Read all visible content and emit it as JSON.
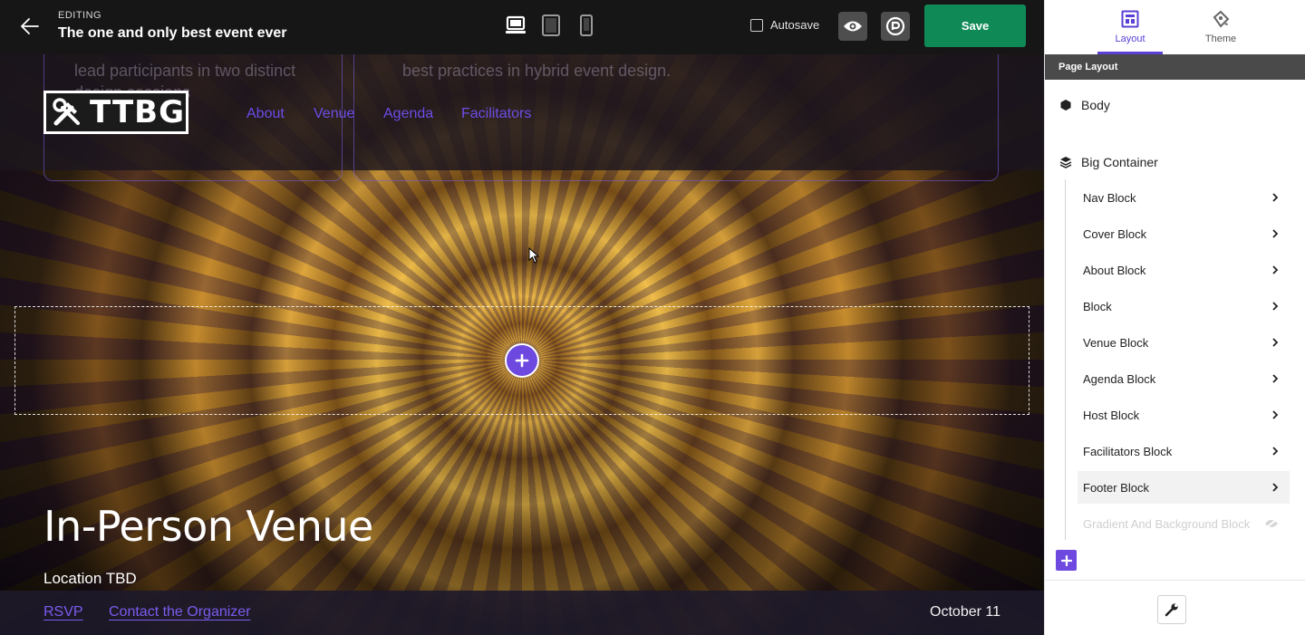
{
  "editor": {
    "editing_label": "EDITING",
    "title": "The one and only best event ever",
    "autosave_label": "Autosave",
    "save_label": "Save",
    "devices": [
      "desktop-icon",
      "tablet-icon",
      "mobile-icon"
    ]
  },
  "preview": {
    "ghost_text_left": "lead participants in two distinct",
    "ghost_text_left_2": "design sessions",
    "ghost_text_right": "best practices in hybrid event design.",
    "logo_text": "TTBG",
    "nav": [
      "About",
      "Venue",
      "Agenda",
      "Facilitators"
    ],
    "venue_title": "In-Person Venue",
    "venue_location": "Location TBD",
    "footer_links": [
      "RSVP",
      "Contact the Organizer"
    ],
    "footer_date": "October 11",
    "accent_color": "#6b4de6"
  },
  "panel": {
    "tabs": [
      {
        "label": "Layout",
        "icon": "layout-icon",
        "active": true
      },
      {
        "label": "Theme",
        "icon": "theme-icon",
        "active": false
      }
    ],
    "section_title": "Page Layout",
    "body_label": "Body",
    "container_label": "Big Container",
    "blocks": [
      {
        "label": "Nav Block",
        "state": "normal"
      },
      {
        "label": "Cover Block",
        "state": "normal"
      },
      {
        "label": "About Block",
        "state": "normal"
      },
      {
        "label": "Block",
        "state": "normal"
      },
      {
        "label": "Venue Block",
        "state": "normal"
      },
      {
        "label": "Agenda Block",
        "state": "normal"
      },
      {
        "label": "Host Block",
        "state": "normal"
      },
      {
        "label": "Facilitators Block",
        "state": "normal"
      },
      {
        "label": "Footer Block",
        "state": "hovered"
      },
      {
        "label": "Gradient And Background Block",
        "state": "hidden"
      }
    ]
  }
}
